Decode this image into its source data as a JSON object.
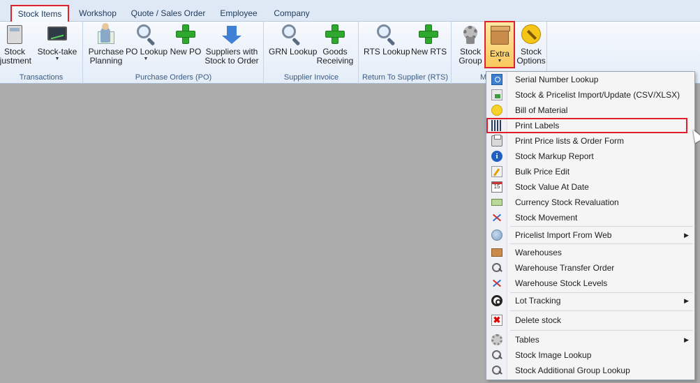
{
  "tabs": [
    {
      "label": "Stock Items",
      "active": true
    },
    {
      "label": "Workshop"
    },
    {
      "label": "Quote / Sales Order"
    },
    {
      "label": "Employee"
    },
    {
      "label": "Company"
    }
  ],
  "ribbon": {
    "groups": [
      {
        "label": "Transactions",
        "buttons": [
          {
            "label": "Stock",
            "label2": "ljustment"
          },
          {
            "label": "Stock-take",
            "has_arrow": true
          }
        ]
      },
      {
        "label": "Purchase Orders (PO)",
        "buttons": [
          {
            "label": "Purchase",
            "label2": "Planning"
          },
          {
            "label": "PO Lookup",
            "has_arrow": true
          },
          {
            "label": "New PO"
          },
          {
            "label": "Suppliers with",
            "label2": "Stock to Order"
          }
        ]
      },
      {
        "label": "Supplier Invoice",
        "buttons": [
          {
            "label": "GRN Lookup"
          },
          {
            "label": "Goods",
            "label2": "Receiving"
          }
        ]
      },
      {
        "label": "Return To Supplier (RTS)",
        "buttons": [
          {
            "label": "RTS Lookup"
          },
          {
            "label": "New RTS"
          }
        ]
      },
      {
        "label": "M",
        "buttons": [
          {
            "label": "Stock",
            "label2": "Group"
          },
          {
            "label": "Extra",
            "has_arrow": true,
            "pressed": true
          },
          {
            "label": "Stock",
            "label2": "Options"
          }
        ]
      }
    ]
  },
  "extra_menu": {
    "items": [
      {
        "label": "Serial Number Lookup",
        "icon": "search-icon"
      },
      {
        "label": "Stock & Pricelist Import/Update (CSV/XLSX)",
        "icon": "import-icon"
      },
      {
        "label": "Bill of Material",
        "icon": "yellow-circle-icon"
      },
      {
        "label": "Print Labels",
        "icon": "barcode-icon",
        "highlighted": true
      },
      {
        "label": "Print Price lists & Order Form",
        "icon": "printer-icon"
      },
      {
        "label": "Stock Markup Report",
        "icon": "info-icon"
      },
      {
        "label": "Bulk Price Edit",
        "icon": "edit-icon"
      },
      {
        "label": "Stock Value At Date",
        "icon": "calendar-icon",
        "icon_text": "15"
      },
      {
        "label": "Currency Stock Revaluation",
        "icon": "money-icon"
      },
      {
        "label": "Stock Movement",
        "icon": "graph-icon"
      },
      {
        "label": "Pricelist Import From Web",
        "icon": "globe-icon",
        "submenu": true
      },
      {
        "label": "Warehouses",
        "icon": "box-icon"
      },
      {
        "label": "Warehouse Transfer Order",
        "icon": "magnifier-icon"
      },
      {
        "label": "Warehouse Stock Levels",
        "icon": "graph-icon"
      },
      {
        "label": "Lot Tracking",
        "icon": "lot-tracking-icon",
        "submenu": true
      },
      {
        "label": "Delete stock",
        "icon": "delete-icon",
        "icon_text": "✖"
      },
      {
        "label": "Tables",
        "icon": "gear-icon",
        "submenu": true
      },
      {
        "label": "Stock Image Lookup",
        "icon": "magnifier-icon"
      },
      {
        "label": "Stock Additional Group Lookup",
        "icon": "magnifier-icon"
      }
    ],
    "submenu_arrow": "▶"
  },
  "colors": {
    "highlight_box": "#e0202b",
    "workspace": "#ababab",
    "ribbon_top": "#f6f9fd",
    "pressed_button": "#f8c85e"
  }
}
